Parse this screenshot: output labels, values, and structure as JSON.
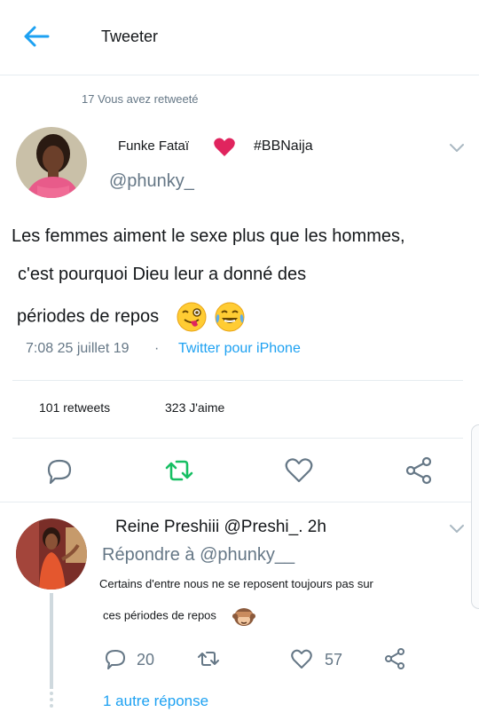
{
  "header": {
    "title": "Tweeter"
  },
  "retweet_label": "17 Vous avez retweeté",
  "tweet": {
    "author_name": "Funke Fataï",
    "tag": "#BBNaija",
    "handle": "@phunky_",
    "lines": [
      "Les femmes aiment le sexe plus que les hommes,",
      "c'est pourquoi Dieu leur a donné des",
      "périodes de repos"
    ],
    "emojis": [
      "winking-tongue-face",
      "tears-of-joy-face"
    ],
    "time": "7:08 25 juillet 19",
    "separator": "·",
    "source": "Twitter pour iPhone",
    "retweets": "101 retweets",
    "likes": "323 J'aime"
  },
  "reply": {
    "header": "Reine Preshiii @Preshi_. 2h",
    "replying_to": "Répondre à @phunky__",
    "text_lines": [
      "Certains d'entre nous ne se reposent toujours pas sur",
      "ces périodes de repos"
    ],
    "emoji": "see-no-evil-monkey",
    "reply_count": "20",
    "like_count": "57",
    "more_replies": "1 autre réponse"
  },
  "colors": {
    "accent": "#1da1f2",
    "retweet_green": "#17bf63",
    "heart_red": "#e0245e",
    "muted": "#657786",
    "text": "#14171a"
  },
  "icons": [
    "back-arrow-icon",
    "heart-icon",
    "chevron-down-icon",
    "reply-icon",
    "retweet-icon",
    "like-icon",
    "share-icon"
  ]
}
